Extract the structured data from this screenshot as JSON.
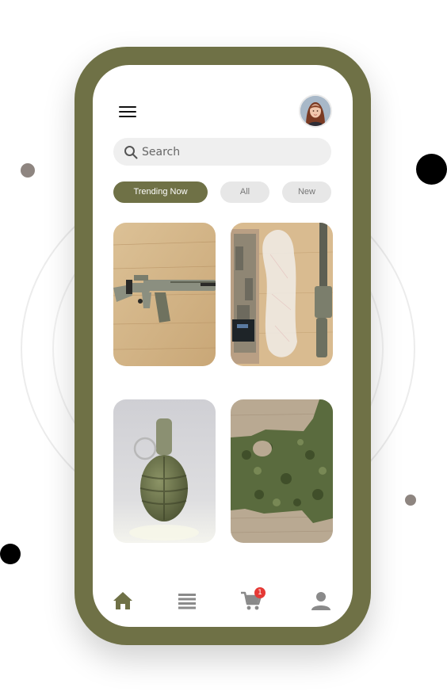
{
  "header": {
    "menu_icon": "hamburger-menu-icon",
    "avatar_icon": "user-avatar"
  },
  "search": {
    "placeholder": "Search",
    "value": "",
    "icon": "search-icon"
  },
  "filters": [
    {
      "label": "Trending Now",
      "active": true
    },
    {
      "label": "All",
      "active": false
    },
    {
      "label": "New",
      "active": false
    }
  ],
  "products": [
    {
      "image": "assault-rifle-on-wood-floor"
    },
    {
      "image": "rifle-parts-in-box"
    },
    {
      "image": "hand-grenade"
    },
    {
      "image": "camouflage-vest"
    }
  ],
  "bottom_nav": [
    {
      "icon": "home-icon",
      "active": true
    },
    {
      "icon": "list-icon",
      "active": false
    },
    {
      "icon": "cart-icon",
      "active": false,
      "badge": "1"
    },
    {
      "icon": "profile-icon",
      "active": false
    }
  ],
  "colors": {
    "accent": "#6f7146",
    "chip_inactive": "#e7e7e7",
    "badge": "#e53935",
    "nav_inactive": "#8a8a8a"
  }
}
